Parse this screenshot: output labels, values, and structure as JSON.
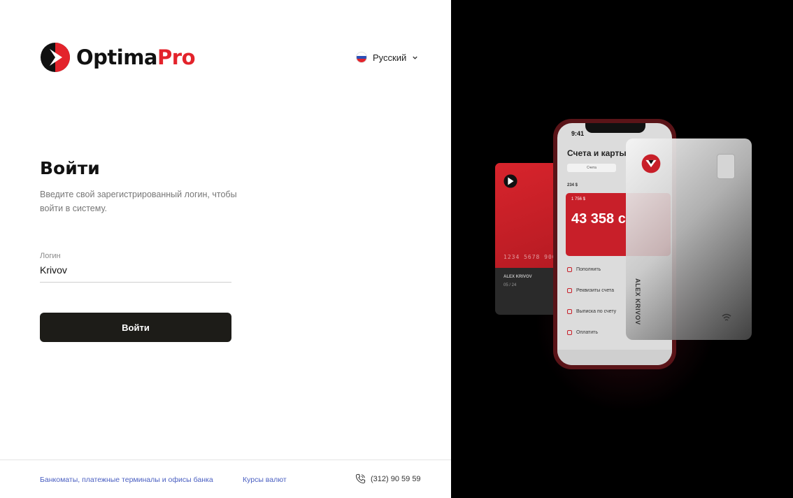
{
  "brand": {
    "name_main": "Optima",
    "name_accent": "Pro"
  },
  "language": {
    "label": "Русский"
  },
  "login": {
    "title": "Войти",
    "subtitle": "Введите свой зарегистрированный логин, чтобы войти в систему.",
    "field_label": "Логин",
    "field_value": "Krivov",
    "submit_label": "Войти"
  },
  "footer": {
    "atm_link": "Банкоматы, платежные терминалы и офисы банка",
    "rates_link": "Курсы валют",
    "phone": "(312) 90 59 59"
  },
  "promo": {
    "phone_time": "9:41",
    "phone_title": "Счета и карты",
    "phone_tab": "Счета",
    "phone_sum": "234 $",
    "card_small": "1 756 $",
    "card_balance": "43 358 с",
    "menu_items": [
      "Пополнить",
      "Реквизиты счета",
      "Выписка по счету",
      "Оплатить"
    ],
    "red_card_number": "1234 5678 900",
    "red_card_name": "ALEX KRIVOV",
    "red_card_exp": "05 / 24",
    "white_card_name": "ALEX KRIVOV"
  },
  "colors": {
    "accent": "#e3232b",
    "button": "#1d1c18",
    "link": "#4a5fc1"
  },
  "icons": [
    "optima-logo-icon",
    "russia-flag-icon",
    "chevron-down-icon",
    "phone-icon"
  ]
}
